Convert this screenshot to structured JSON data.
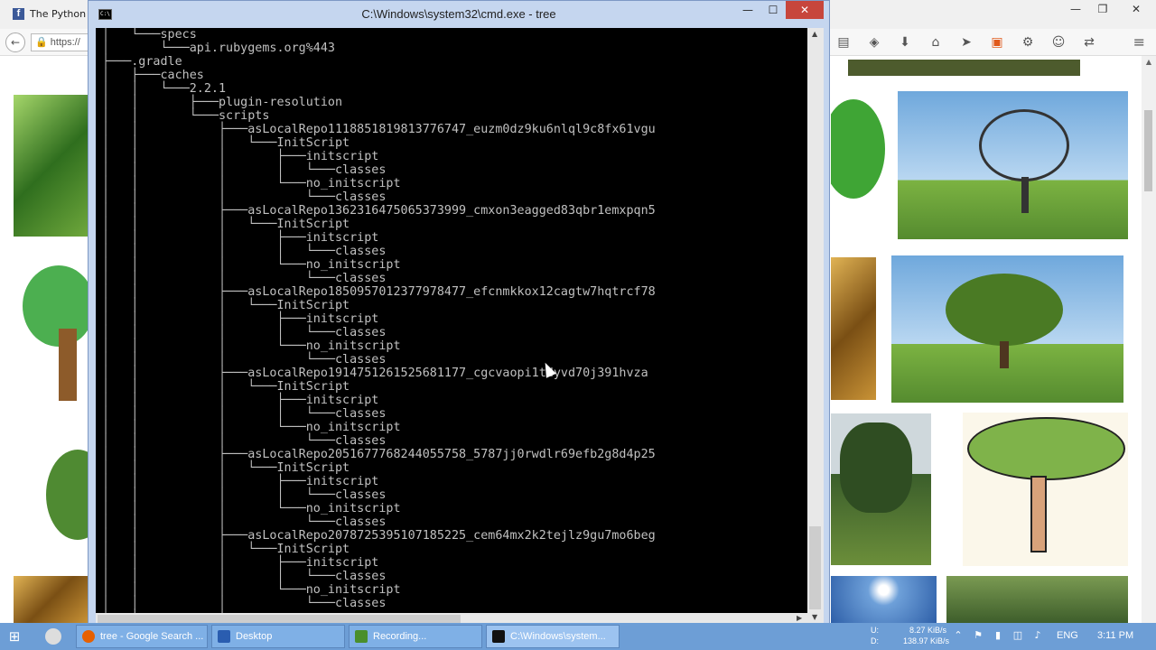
{
  "browser": {
    "tab_title": "The Python",
    "url": "https://",
    "tab_icon": "facebook-icon",
    "toolbar_icons": [
      "reading-list-icon",
      "pocket-icon",
      "download-icon",
      "home-icon",
      "send-icon",
      "extension-icon",
      "addon-icon",
      "emoji-icon",
      "share-icon",
      "menu-icon"
    ]
  },
  "cmd": {
    "title": "C:\\Windows\\system32\\cmd.exe - tree",
    "lines": [
      "│   └───specs",
      "│       └───api.rubygems.org%443",
      "├───.gradle",
      "│   ├───caches",
      "│   │   └───2.2.1",
      "│   │       ├───plugin-resolution",
      "│   │       └───scripts",
      "│   │           ├───asLocalRepo1118851819813776747_euzm0dz9ku6nlql9c8fx61vgu",
      "│   │           │   └───InitScript",
      "│   │           │       ├───initscript",
      "│   │           │       │   └───classes",
      "│   │           │       └───no_initscript",
      "│   │           │           └───classes",
      "│   │           ├───asLocalRepo1362316475065373999_cmxon3eagged83qbr1emxpqn5",
      "│   │           │   └───InitScript",
      "│   │           │       ├───initscript",
      "│   │           │       │   └───classes",
      "│   │           │       └───no_initscript",
      "│   │           │           └───classes",
      "│   │           ├───asLocalRepo1850957012377978477_efcnmkkox12cagtw7hqtrcf78",
      "│   │           │   └───InitScript",
      "│   │           │       ├───initscript",
      "│   │           │       │   └───classes",
      "│   │           │       └───no_initscript",
      "│   │           │           └───classes",
      "│   │           ├───asLocalRepo1914751261525681177_cgcvaopi1tdyvd70j391hvza",
      "│   │           │   └───InitScript",
      "│   │           │       ├───initscript",
      "│   │           │       │   └───classes",
      "│   │           │       └───no_initscript",
      "│   │           │           └───classes",
      "│   │           ├───asLocalRepo2051677768244055758_5787jj0rwdlr69efb2g8d4p25",
      "│   │           │   └───InitScript",
      "│   │           │       ├───initscript",
      "│   │           │       │   └───classes",
      "│   │           │       └───no_initscript",
      "│   │           │           └───classes",
      "│   │           ├───asLocalRepo2078725395107185225_cem64mx2k2tejlz9gu7mo6beg",
      "│   │           │   └───InitScript",
      "│   │           │       ├───initscript",
      "│   │           │       │   └───classes",
      "│   │           │       └───no_initscript",
      "│   │           │           └───classes",
      "│   │           │"
    ]
  },
  "taskbar": {
    "items": [
      {
        "label": "tree - Google Search ...",
        "icon": "firefox-icon"
      },
      {
        "label": "Desktop",
        "icon": "desktop-icon"
      },
      {
        "label": "Recording...",
        "icon": "recording-icon"
      },
      {
        "label": "C:\\Windows\\system...",
        "icon": "cmd-icon"
      }
    ],
    "net_labels": "U:\nD:",
    "net_rates": "8.27 KiB/s\n138.97 KiB/s",
    "language": "ENG",
    "time": "3:11 PM"
  }
}
